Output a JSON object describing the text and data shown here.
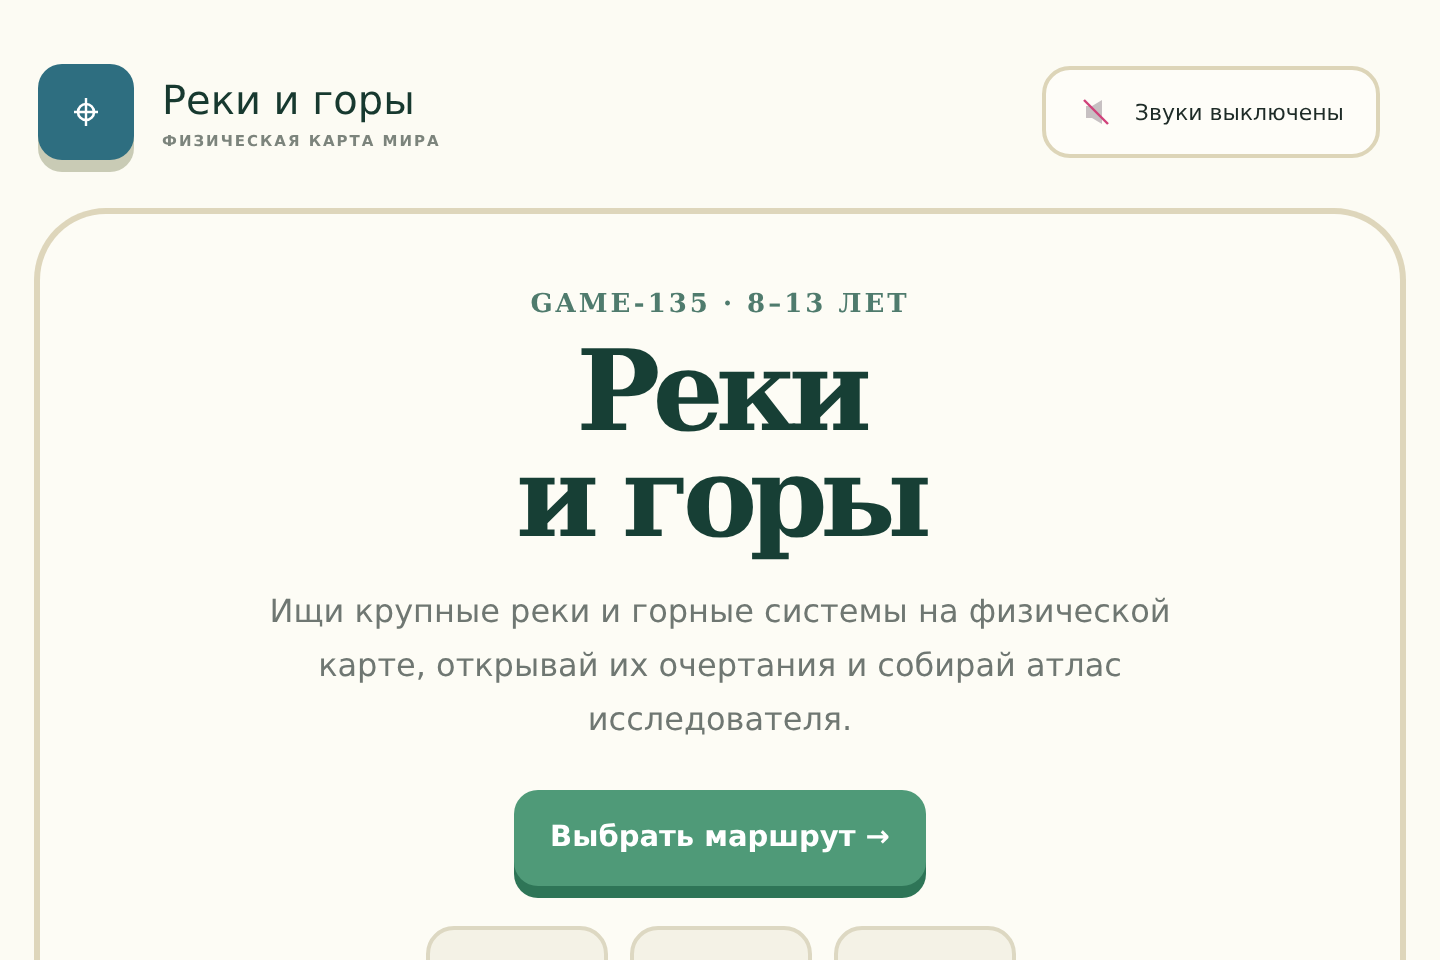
{
  "header": {
    "title": "Реки и горы",
    "subtitle": "ФИЗИЧЕСКАЯ КАРТА МИРА",
    "sound_button": "Звуки выключены"
  },
  "hero": {
    "eyebrow": "GAME-135 · 8–13 ЛЕТ",
    "title_lines": [
      "Реки",
      "и горы"
    ],
    "description": "Ищи крупные реки и горные системы на физической карте, открывай их очертания и собирай атлас исследователя.",
    "cta": "Выбрать маршрут →"
  }
}
